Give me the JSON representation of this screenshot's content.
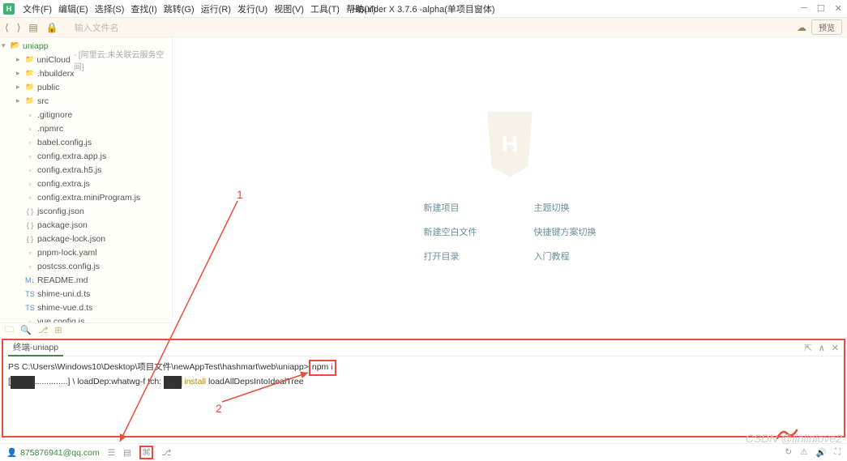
{
  "window": {
    "title": "HBuilder X 3.7.6 -alpha(单项目窗体)"
  },
  "menu": [
    "文件(F)",
    "编辑(E)",
    "选择(S)",
    "查找(I)",
    "跳转(G)",
    "运行(R)",
    "发行(U)",
    "视图(V)",
    "工具(T)",
    "帮助(Y)"
  ],
  "toolbar": {
    "search_placeholder": "输入文件名",
    "preview": "预览"
  },
  "tree": {
    "root": {
      "name": "uniapp"
    },
    "items": [
      {
        "icon": "folder",
        "name": "uniCloud",
        "annot": "- [阿里云:未关联云服务空间]",
        "indent": 1,
        "arrow": "▸"
      },
      {
        "icon": "folder",
        "name": ".hbuilderx",
        "indent": 1,
        "arrow": "▸"
      },
      {
        "icon": "folder",
        "name": "public",
        "indent": 1,
        "arrow": "▸"
      },
      {
        "icon": "folder",
        "name": "src",
        "indent": 1,
        "arrow": "▸"
      },
      {
        "icon": "file",
        "name": ".gitignore",
        "indent": 1
      },
      {
        "icon": "file",
        "name": ".npmrc",
        "indent": 1
      },
      {
        "icon": "js",
        "name": "babel.config.js",
        "indent": 1
      },
      {
        "icon": "js",
        "name": "config.extra.app.js",
        "indent": 1
      },
      {
        "icon": "js",
        "name": "config.extra.h5.js",
        "indent": 1
      },
      {
        "icon": "js",
        "name": "config.extra.js",
        "indent": 1
      },
      {
        "icon": "js",
        "name": "config.extra.miniProgram.js",
        "indent": 1
      },
      {
        "icon": "json",
        "name": "jsconfig.json",
        "indent": 1
      },
      {
        "icon": "json",
        "name": "package.json",
        "indent": 1
      },
      {
        "icon": "json",
        "name": "package-lock.json",
        "indent": 1
      },
      {
        "icon": "file",
        "name": "pnpm-lock.yaml",
        "indent": 1
      },
      {
        "icon": "js",
        "name": "postcss.config.js",
        "indent": 1
      },
      {
        "icon": "md",
        "name": "README.md",
        "indent": 1
      },
      {
        "icon": "ts",
        "name": "shime-uni.d.ts",
        "indent": 1
      },
      {
        "icon": "ts",
        "name": "shime-vue.d.ts",
        "indent": 1
      },
      {
        "icon": "js",
        "name": "vue.config.js",
        "indent": 1
      }
    ]
  },
  "welcome": {
    "col1": [
      "新建项目",
      "新建空白文件",
      "打开目录"
    ],
    "col2": [
      "主题切换",
      "快捷键方案切换",
      "入门教程"
    ]
  },
  "terminal": {
    "tab": "终端-uniapp",
    "line1_prefix": "PS C:\\Users\\Windows10\\Desktop\\项目文件\\newAppTest\\hashmart\\web\\uniapp>",
    "line1_cmd": " npm i",
    "line2_a": "[",
    "line2_bar1": "████",
    "line2_b": "..............] \\ loadDep:whatwg-f tch: ",
    "line2_bar2": "███",
    "line2_install": " install ",
    "line2_c": "loadAllDepsIntoIdealTree"
  },
  "status": {
    "user": "875876941@qq.com"
  },
  "annotations": {
    "n1": "1",
    "n2": "2"
  },
  "watermark": "CSDN @linlinlove2"
}
